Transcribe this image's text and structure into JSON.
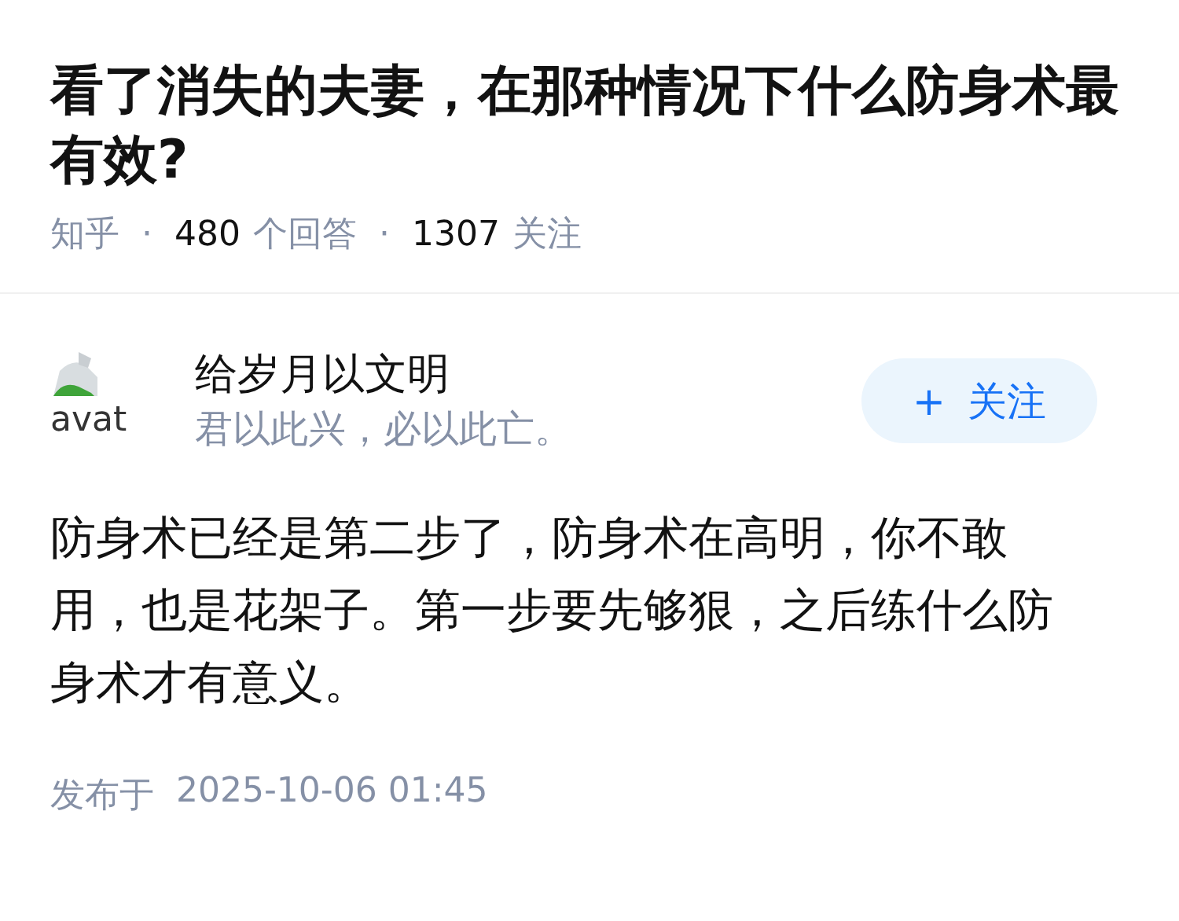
{
  "question": {
    "title": "看了消失的夫妻，在那种情况下什么防身术最有效?",
    "meta": {
      "separator": "·",
      "source": "知乎",
      "answers_count": "480",
      "answers_label": "个回答",
      "followers_count": "1307",
      "followers_label": "关注"
    }
  },
  "answer": {
    "author": {
      "avatar_alt": "avat",
      "name": "给岁月以文明",
      "bio": "君以此兴，必以此亡。"
    },
    "follow_button": {
      "icon": "+",
      "label": "关注"
    },
    "content": "防身术已经是第二步了，防身术在高明，你不敢用，也是花架子。第一步要先够狠，之后练什么防身术才有意义。",
    "published_label": "发布于",
    "published_time": "2025-10-06 01:45"
  }
}
